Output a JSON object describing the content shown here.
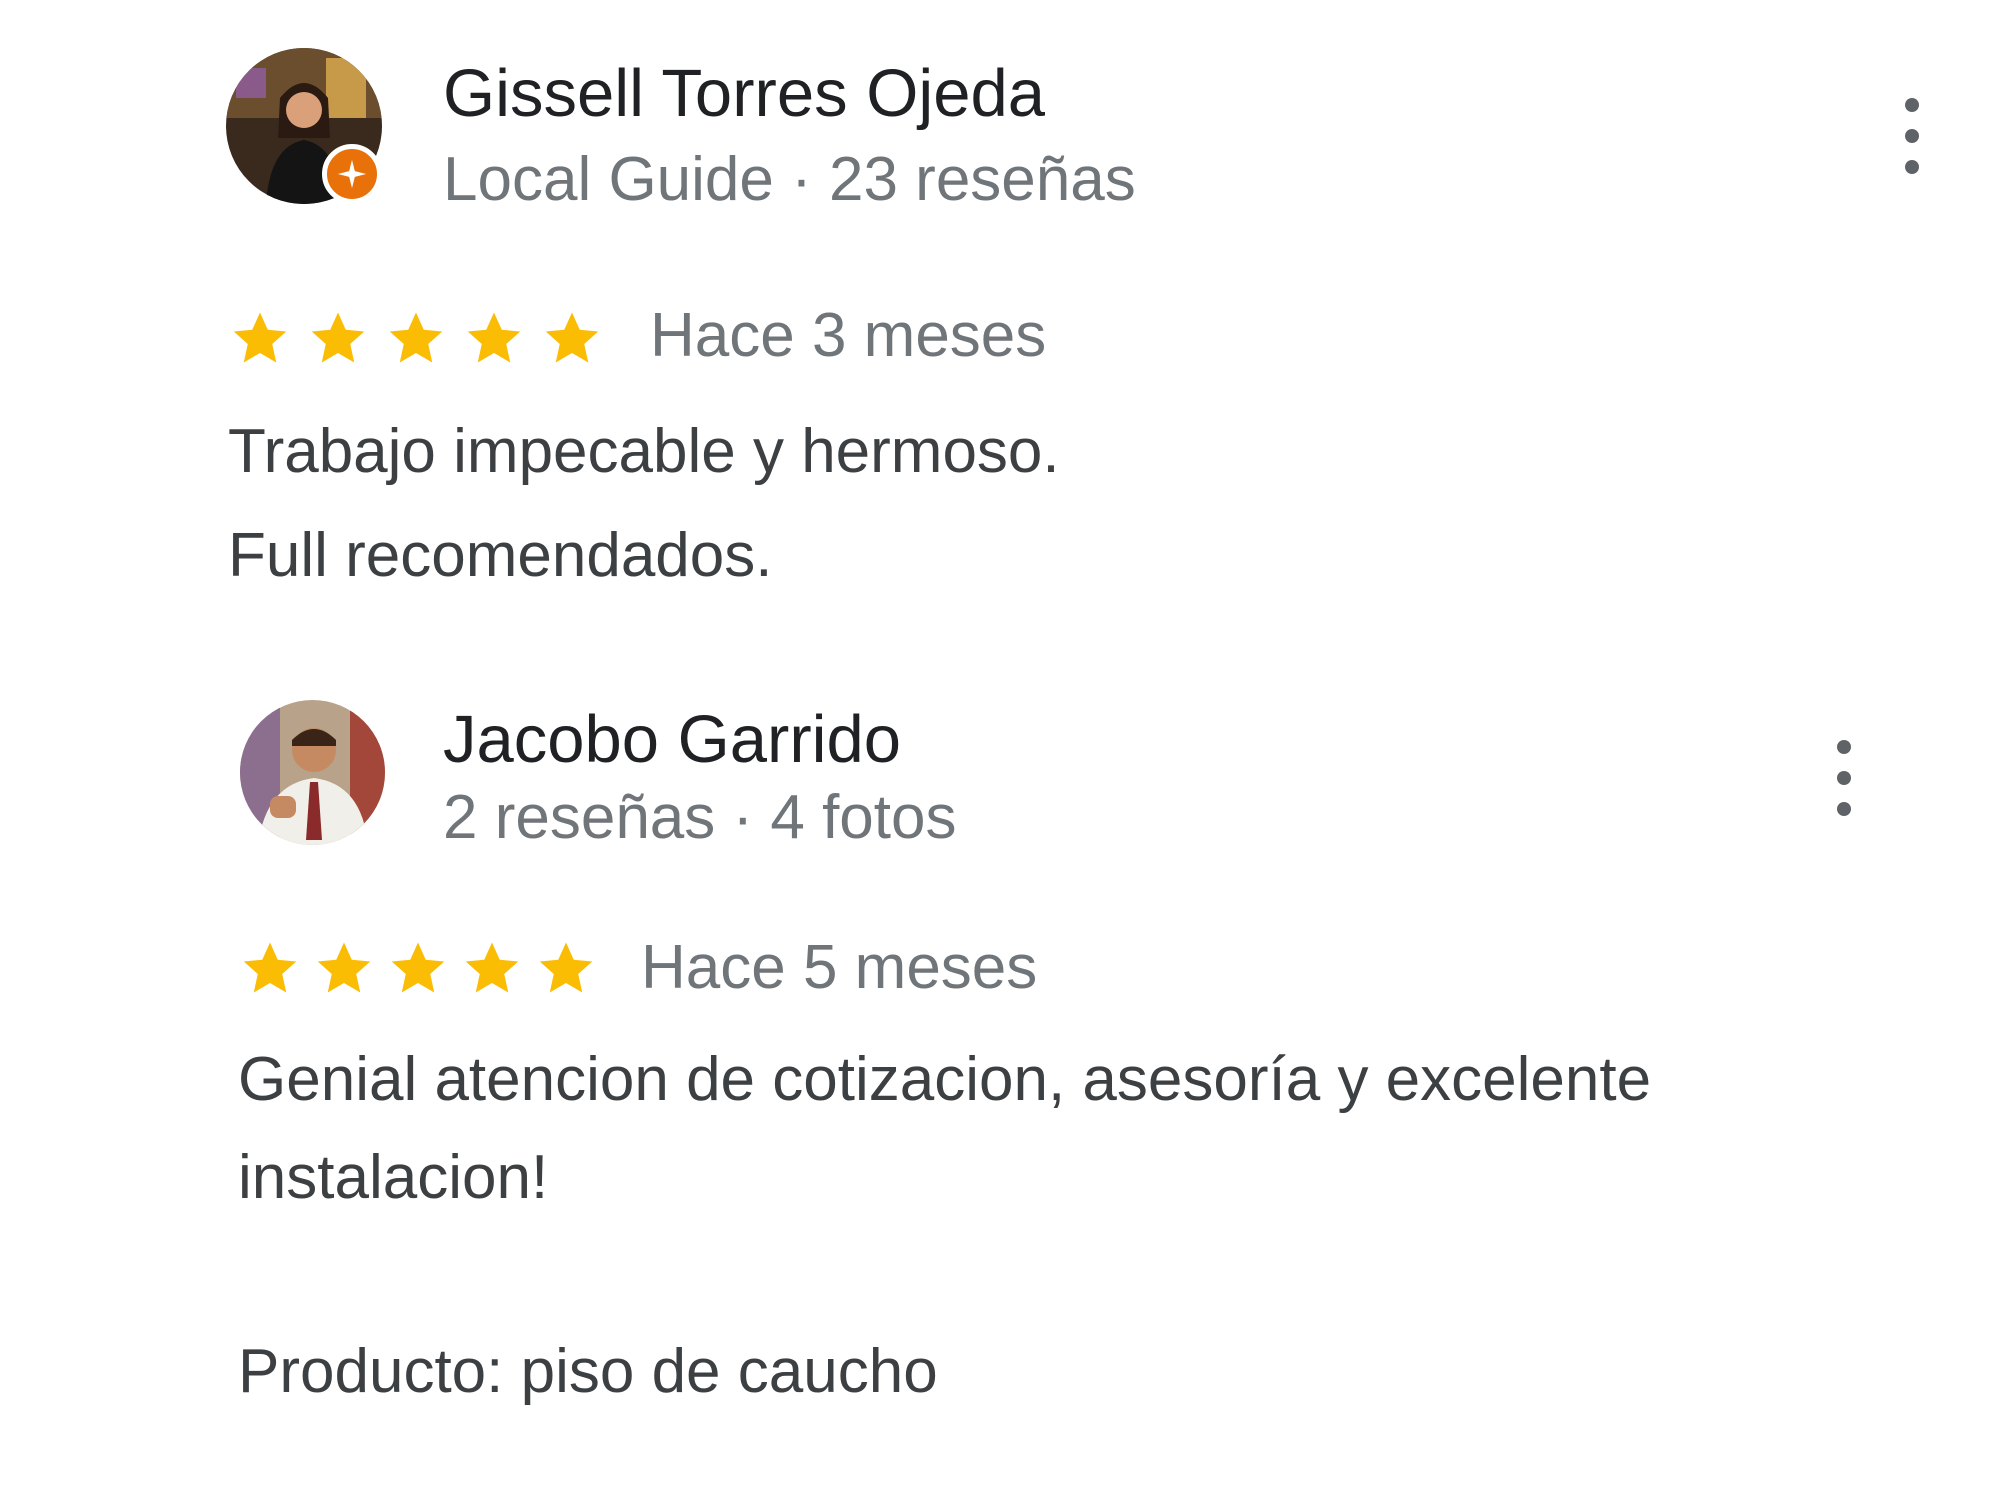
{
  "reviews": [
    {
      "author": "Gissell Torres Ojeda",
      "meta": "Local Guide · 23 reseñas",
      "badge_icon": "local-guide-star-icon",
      "rating": 5,
      "time": "Hace 3 meses",
      "text_lines": [
        "Trabajo impecable y hermoso.",
        "Full recomendados."
      ]
    },
    {
      "author": "Jacobo Garrido",
      "meta": "2 reseñas · 4 fotos",
      "rating": 5,
      "time": "Hace 5 meses",
      "text_lines": [
        "Genial atencion de cotizacion, asesoría y excelente",
        "instalacion!",
        "",
        "Producto: piso de caucho"
      ]
    }
  ],
  "colors": {
    "star": "#fbbc04",
    "badge": "#e8710a",
    "name": "#202124",
    "meta": "#70757a",
    "body_text": "#3c4043"
  }
}
